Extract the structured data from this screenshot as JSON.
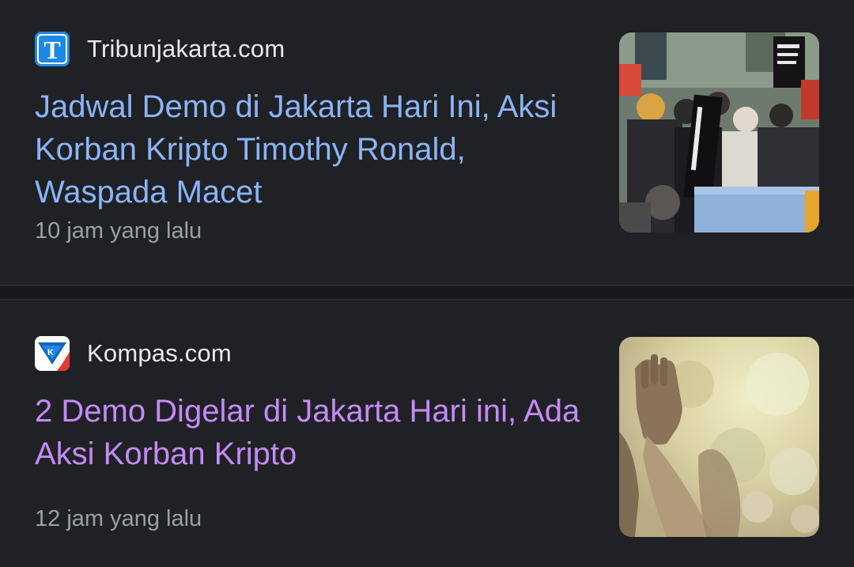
{
  "articles": [
    {
      "source": "Tribunjakarta.com",
      "favicon_icon": "tribun-t-logo-icon",
      "favicon_color": "#1e88e5",
      "headline": "Jadwal Demo di Jakarta Hari Ini, Aksi Korban Kripto Timothy Ronald, Waspada Macet",
      "headline_color": "#8ab4f8",
      "time": "10 jam yang lalu",
      "thumbnail_icon": "protest-crowd-photo"
    },
    {
      "source": "Kompas.com",
      "favicon_icon": "kompas-logo-icon",
      "favicon_color": "#1565c0",
      "headline": "2 Demo Digelar di Jakarta Hari ini, Ada Aksi Korban Kripto",
      "headline_color": "#c58af9",
      "time": "12 jam yang lalu",
      "thumbnail_icon": "raised-hands-photo"
    }
  ]
}
